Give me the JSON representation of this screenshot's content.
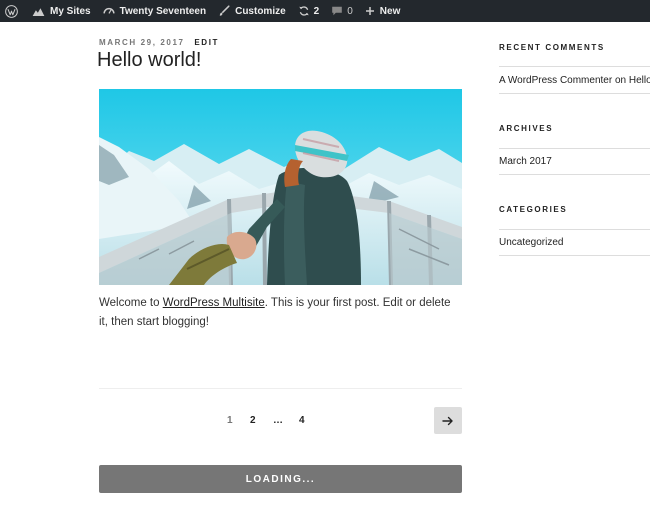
{
  "adminbar": {
    "my_sites": "My Sites",
    "site_name": "Twenty Seventeen",
    "customize": "Customize",
    "updates_count": "2",
    "comments_count": "0",
    "new_label": "New"
  },
  "post": {
    "date": "MARCH 29, 2017",
    "edit_label": "EDIT",
    "title": "Hello world!",
    "body_before": "Welcome to ",
    "body_link": "WordPress Multisite",
    "body_after": ". This is your first post. Edit or delete it, then start blogging!"
  },
  "pagination": {
    "pages": [
      "1",
      "2",
      "…",
      "4"
    ],
    "current": "1"
  },
  "loading_label": "LOADING...",
  "sidebar": {
    "recent_comments_title": "RECENT COMMENTS",
    "recent_comment": "A WordPress Commenter on Hello",
    "archives_title": "ARCHIVES",
    "archive_item": "March 2017",
    "categories_title": "CATEGORIES",
    "category_item": "Uncategorized"
  },
  "colors": {
    "adminbar_bg": "#23282d",
    "loading_bg": "#767676",
    "next_button_bg": "#dddddd"
  }
}
